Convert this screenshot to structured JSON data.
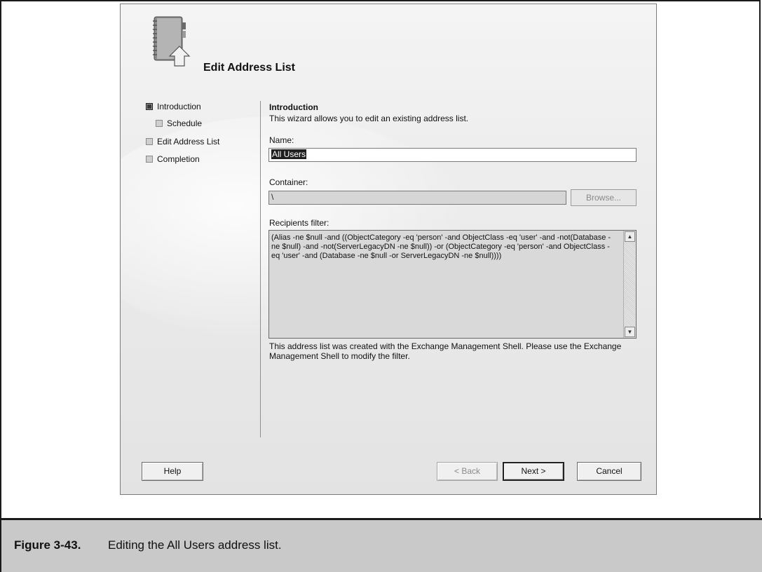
{
  "figure": {
    "number": "Figure 3-43.",
    "caption": "Editing the All Users address list."
  },
  "dialog": {
    "title": "Edit Address List",
    "nav": [
      {
        "label": "Introduction",
        "active": true
      },
      {
        "label": "Schedule",
        "active": false
      },
      {
        "label": "Edit Address List",
        "active": false
      },
      {
        "label": "Completion",
        "active": false
      }
    ],
    "content": {
      "heading": "Introduction",
      "description": "This wizard allows you to edit an existing address list.",
      "name_label": "Name:",
      "name_value": "All Users",
      "container_label": "Container:",
      "container_value": "\\",
      "browse_label": "Browse...",
      "filter_label": "Recipients filter:",
      "filter_value": "(Alias -ne $null -and ((ObjectCategory -eq 'person' -and ObjectClass -eq 'user' -and -not(Database -ne $null) -and -not(ServerLegacyDN -ne $null)) -or (ObjectCategory -eq 'person' -and ObjectClass -eq 'user' -and (Database -ne $null -or ServerLegacyDN -ne $null))))",
      "note": "This address list was created with the Exchange Management Shell. Please use the Exchange Management Shell to modify the filter."
    },
    "buttons": {
      "help": "Help",
      "back": "< Back",
      "next": "Next >",
      "cancel": "Cancel"
    },
    "icons": {
      "header": "address-book-icon",
      "scroll_up": "scroll-up-arrow-icon",
      "scroll_down": "scroll-down-arrow-icon"
    }
  }
}
